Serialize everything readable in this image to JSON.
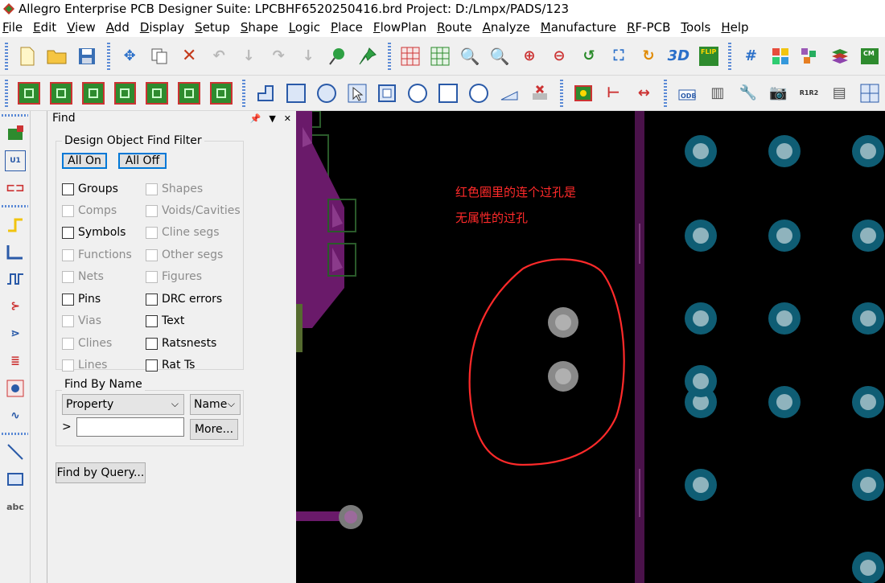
{
  "window": {
    "title": "Allegro Enterprise PCB Designer Suite: LPCBHF6520250416.brd  Project: D:/Lmpx/PADS/123"
  },
  "menu": {
    "items": [
      {
        "label": "File",
        "key": "F"
      },
      {
        "label": "Edit",
        "key": "E"
      },
      {
        "label": "View",
        "key": "V"
      },
      {
        "label": "Add",
        "key": "A"
      },
      {
        "label": "Display",
        "key": "D"
      },
      {
        "label": "Setup",
        "key": "S"
      },
      {
        "label": "Shape",
        "key": "S"
      },
      {
        "label": "Logic",
        "key": "L"
      },
      {
        "label": "Place",
        "key": "P"
      },
      {
        "label": "FlowPlan",
        "key": "F"
      },
      {
        "label": "Route",
        "key": "R"
      },
      {
        "label": "Analyze",
        "key": "A"
      },
      {
        "label": "Manufacture",
        "key": "M"
      },
      {
        "label": "RF-PCB",
        "key": "R"
      },
      {
        "label": "Tools",
        "key": "T"
      },
      {
        "label": "Help",
        "key": "H"
      }
    ]
  },
  "find_panel": {
    "title": "Find",
    "filter_group_label": "Design Object Find Filter",
    "all_on_label": "All On",
    "all_off_label": "All Off",
    "left_filters": [
      {
        "label": "Groups",
        "enabled": true,
        "checked": false
      },
      {
        "label": "Comps",
        "enabled": false,
        "checked": false
      },
      {
        "label": "Symbols",
        "enabled": true,
        "checked": false
      },
      {
        "label": "Functions",
        "enabled": false,
        "checked": false
      },
      {
        "label": "Nets",
        "enabled": false,
        "checked": false
      },
      {
        "label": "Pins",
        "enabled": true,
        "checked": false
      },
      {
        "label": "Vias",
        "enabled": false,
        "checked": false
      },
      {
        "label": "Clines",
        "enabled": false,
        "checked": false
      },
      {
        "label": "Lines",
        "enabled": false,
        "checked": false
      }
    ],
    "right_filters": [
      {
        "label": "Shapes",
        "enabled": false,
        "checked": false
      },
      {
        "label": "Voids/Cavities",
        "enabled": false,
        "checked": false
      },
      {
        "label": "Cline segs",
        "enabled": false,
        "checked": false
      },
      {
        "label": "Other segs",
        "enabled": false,
        "checked": false
      },
      {
        "label": "Figures",
        "enabled": false,
        "checked": false
      },
      {
        "label": "DRC errors",
        "enabled": true,
        "checked": false
      },
      {
        "label": "Text",
        "enabled": true,
        "checked": false
      },
      {
        "label": "Ratsnests",
        "enabled": true,
        "checked": false
      },
      {
        "label": "Rat Ts",
        "enabled": true,
        "checked": false
      }
    ],
    "find_by_name_label": "Find By Name",
    "property_select": "Property",
    "name_select": "Name",
    "name_prompt": ">",
    "name_value": "",
    "more_label": "More...",
    "find_by_query_label": "Find by Query..."
  },
  "canvas": {
    "annotation_line1": "红色圈里的连个过孔是",
    "annotation_line2": "无属性的过孔",
    "colors": {
      "background": "#000000",
      "annotation": "#ff2a2a",
      "etch": "#6a1a6a",
      "via_pad": "#0f5d74"
    }
  }
}
